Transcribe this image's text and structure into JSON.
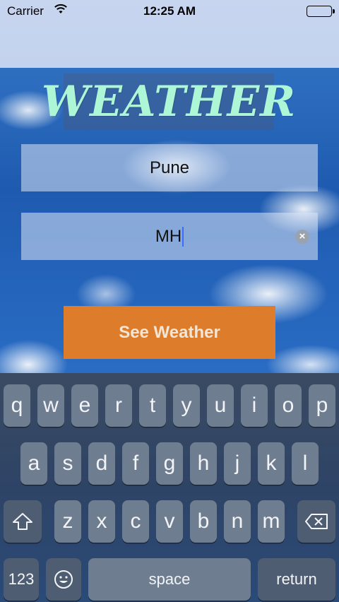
{
  "status": {
    "carrier": "Carrier",
    "time": "12:25 AM"
  },
  "app": {
    "title": "WEATHER"
  },
  "form": {
    "city_value": "Pune",
    "state_value": "MH",
    "submit_label": "See Weather"
  },
  "keyboard": {
    "row1": [
      "q",
      "w",
      "e",
      "r",
      "t",
      "y",
      "u",
      "i",
      "o",
      "p"
    ],
    "row2": [
      "a",
      "s",
      "d",
      "f",
      "g",
      "h",
      "j",
      "k",
      "l"
    ],
    "row3": [
      "z",
      "x",
      "c",
      "v",
      "b",
      "n",
      "m"
    ],
    "numbers_label": "123",
    "space_label": "space",
    "return_label": "return"
  },
  "colors": {
    "title": "#aef7d6",
    "button": "#dd7d2b",
    "sky": "#2a6cc4"
  }
}
